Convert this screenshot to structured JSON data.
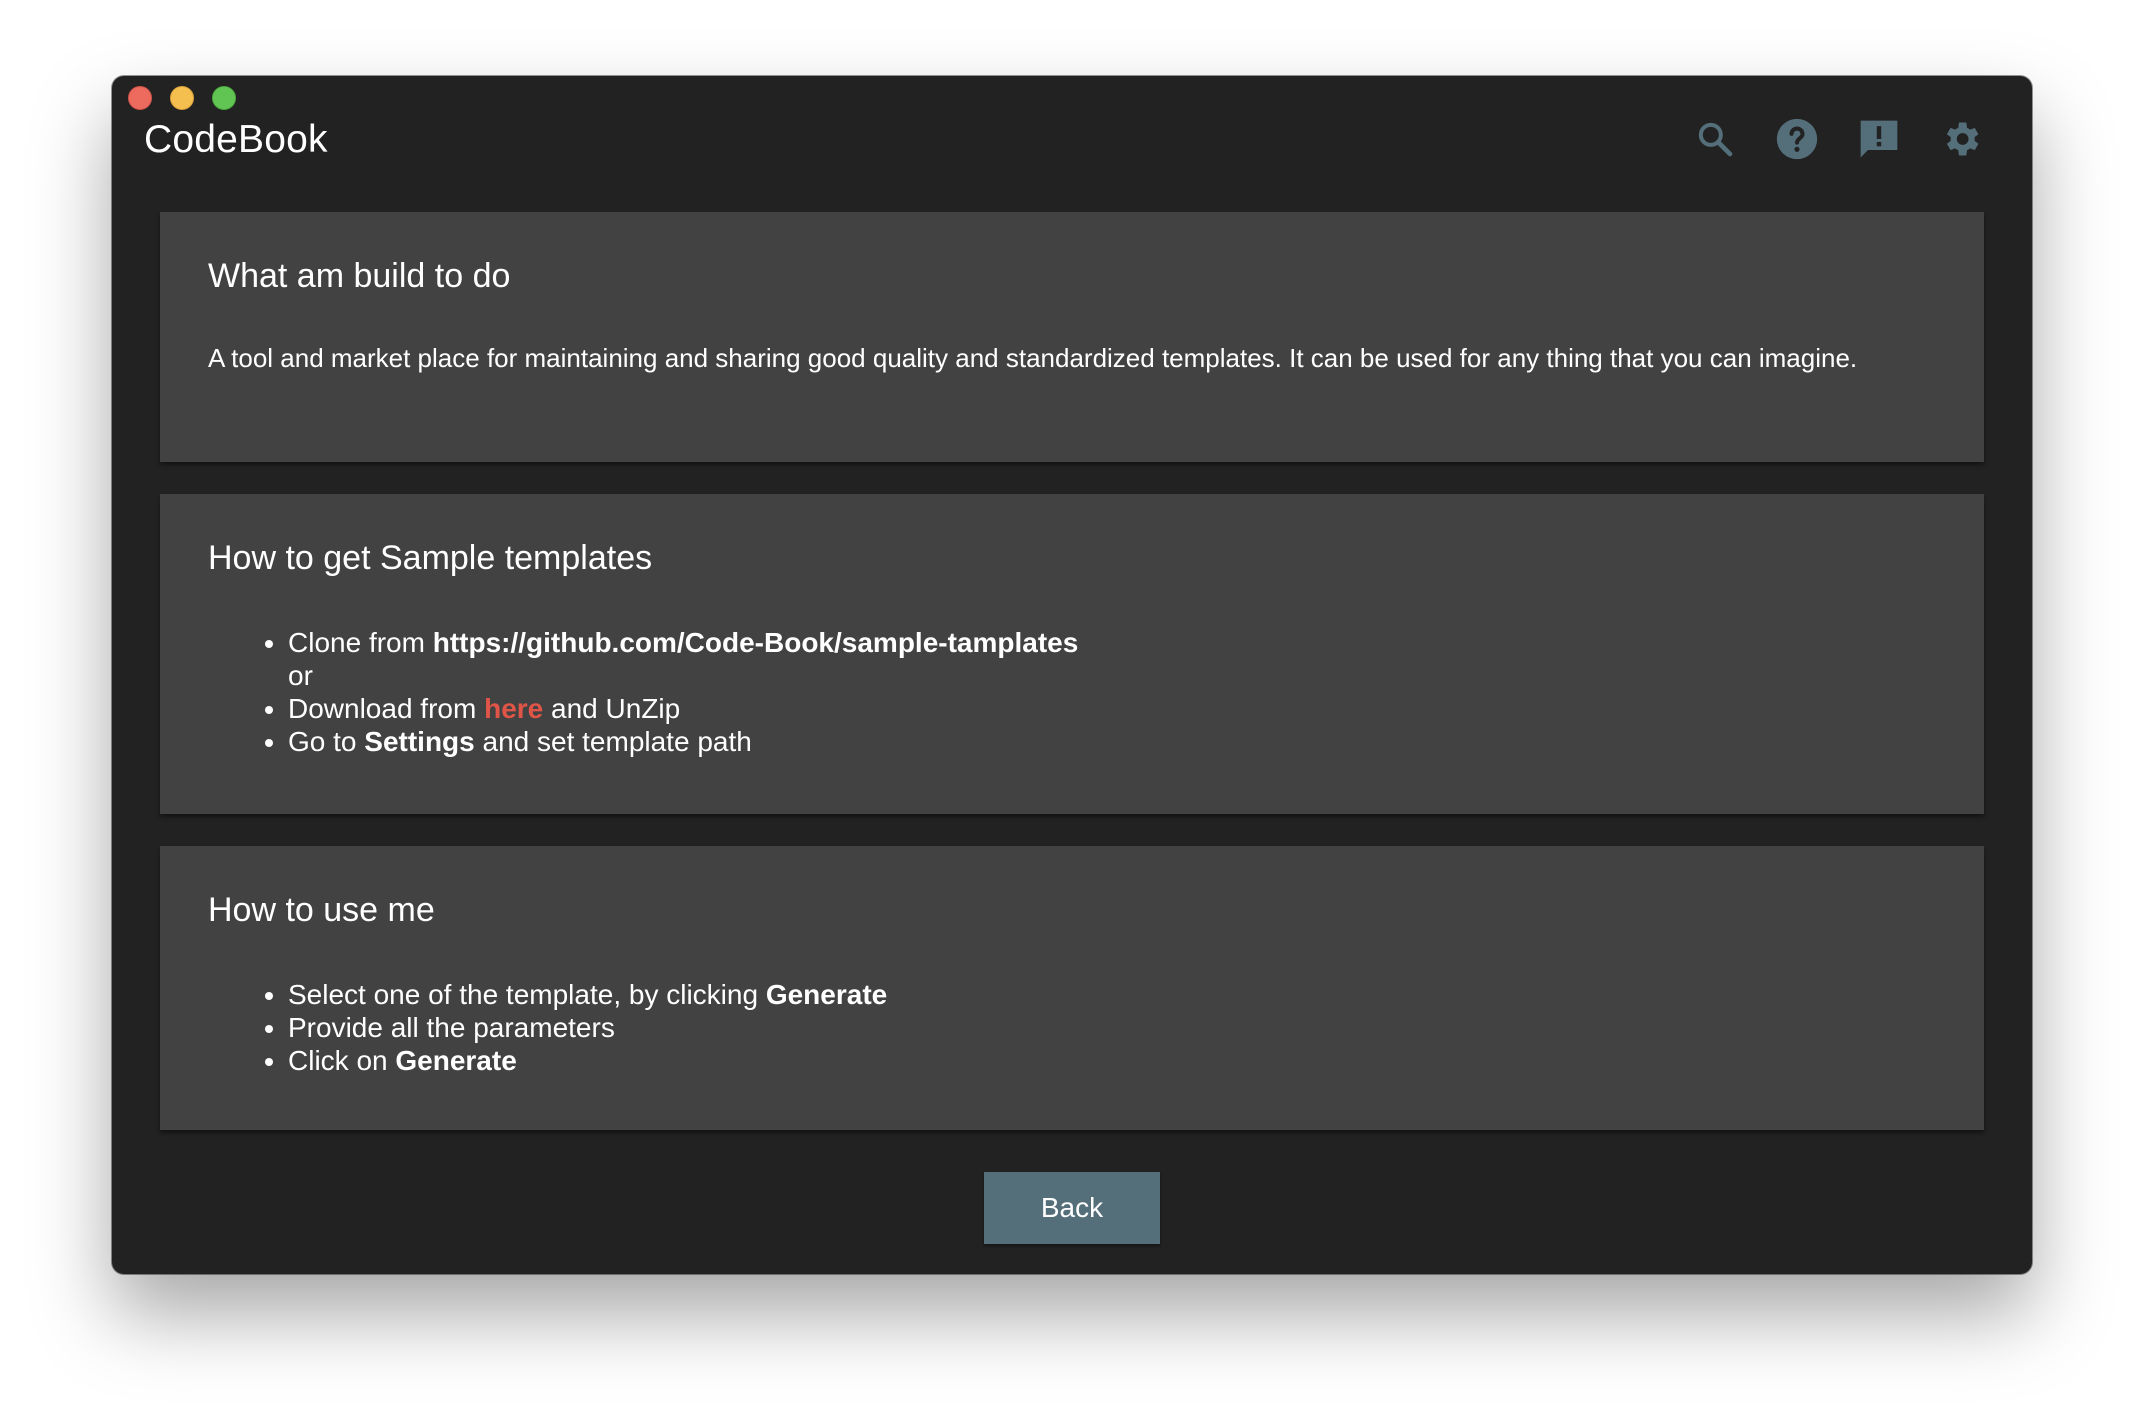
{
  "app": {
    "title": "CodeBook"
  },
  "toolbar": {
    "icons": [
      "search-icon",
      "help-icon",
      "feedback-icon",
      "settings-icon"
    ],
    "icon_color": "#546e7a"
  },
  "sections": {
    "what": {
      "heading": "What am build to do",
      "body": "A tool and market place for maintaining and sharing good quality and standardized templates. It can be used for any thing that you can imagine."
    },
    "samples": {
      "heading": "How to get Sample templates",
      "item1_prefix": "Clone from ",
      "item1_link": "https://github.com/Code-Book/sample-tamplates",
      "item1_or": "or",
      "item2_prefix": "Download from ",
      "item2_link": "here",
      "item2_suffix": " and UnZip",
      "item3_prefix": "Go to ",
      "item3_bold": "Settings",
      "item3_suffix": " and set template path"
    },
    "usage": {
      "heading": "How to use me",
      "item1_prefix": "Select one of the template, by clicking ",
      "item1_bold": "Generate",
      "item2": "Provide all the parameters",
      "item3_prefix": "Click on ",
      "item3_bold": "Generate"
    }
  },
  "back_button": {
    "label": "Back"
  },
  "colors": {
    "window_bg": "#222222",
    "card_bg": "#424242",
    "accent_red": "#e05547",
    "button_bg": "#546e7a"
  }
}
